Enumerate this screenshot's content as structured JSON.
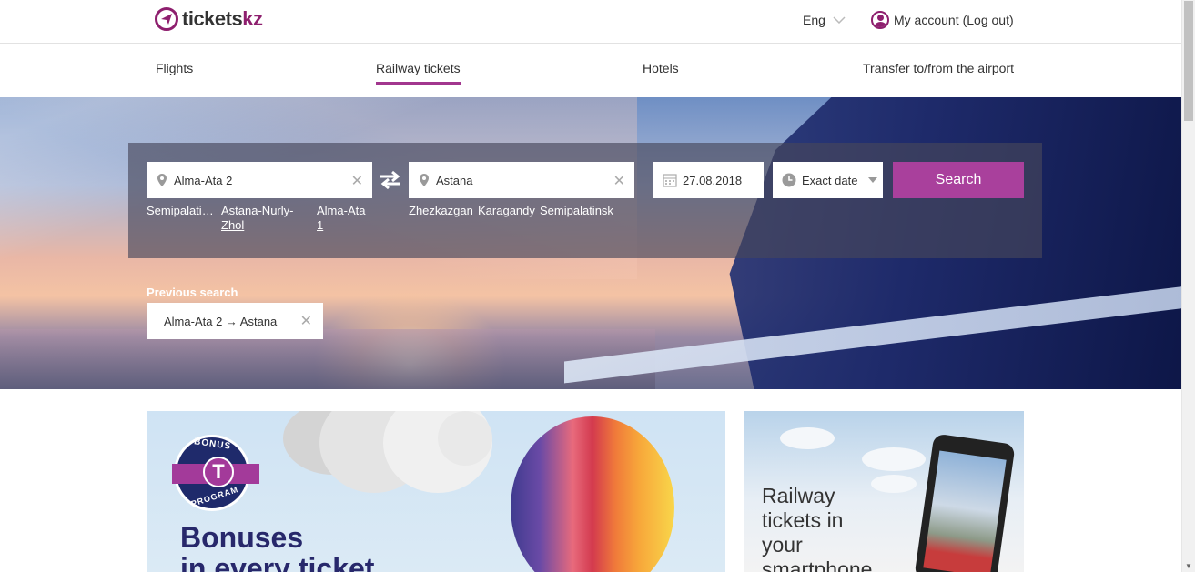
{
  "header": {
    "logo_main": "tickets",
    "logo_accent": "kz",
    "language": "Eng",
    "account_label": "My account",
    "logout_label": "(Log out)"
  },
  "nav": {
    "items": [
      {
        "label": "Flights",
        "active": false
      },
      {
        "label": "Railway tickets",
        "active": true
      },
      {
        "label": "Hotels",
        "active": false
      },
      {
        "label": "Transfer to/from the airport",
        "active": false
      }
    ]
  },
  "search": {
    "from_value": "Alma-Ata 2",
    "to_value": "Astana",
    "date_value": "27.08.2018",
    "date_mode": "Exact date",
    "button_label": "Search",
    "from_suggestions": [
      "Semipalati…",
      "Astana-Nurly-",
      "Zhol",
      "Alma-Ata",
      "1"
    ],
    "to_suggestions": [
      "Zhezkazgan",
      "Karagandy",
      "Semipalatinsk"
    ]
  },
  "previous_search": {
    "title": "Previous search",
    "route": "Alma-Ata 2 → Astana"
  },
  "banners": {
    "bonus_top": "BONUS",
    "bonus_letter": "T",
    "bonus_bottom": "PROGRAM",
    "bonus_heading_1": "Bonuses",
    "bonus_heading_2": "in every ticket",
    "app_line_1": "Railway",
    "app_line_2": "tickets in",
    "app_line_3": "your",
    "app_line_4": "smartphone"
  },
  "colors": {
    "brand": "#8e1f6e",
    "accent_button": "#a9409c"
  }
}
